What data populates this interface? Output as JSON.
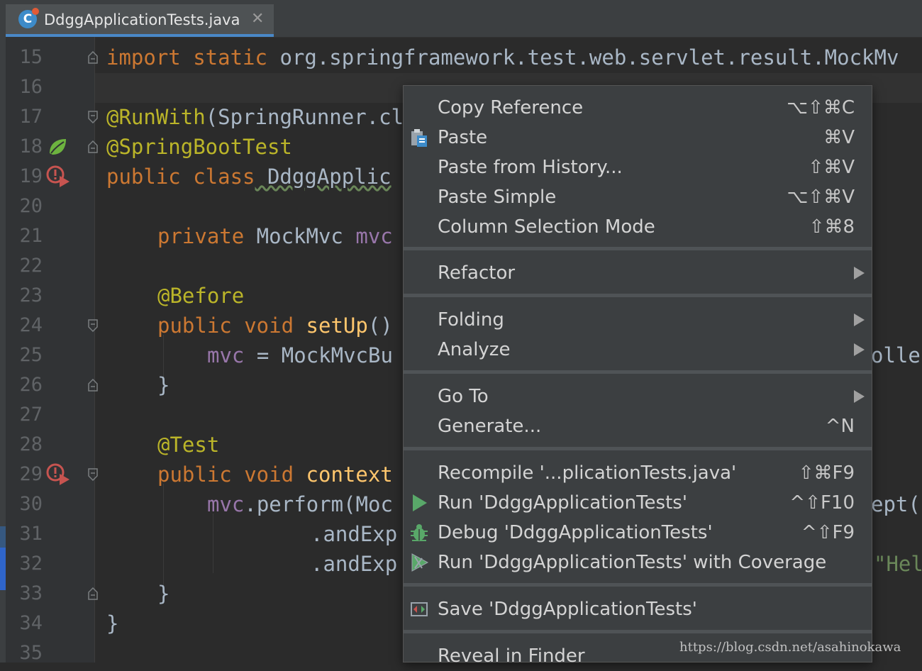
{
  "tab": {
    "title": "DdggApplicationTests.java",
    "icon_letter": "C",
    "close": "✕"
  },
  "gutter": {
    "line_numbers": [
      "15",
      "16",
      "17",
      "18",
      "19",
      "20",
      "21",
      "22",
      "23",
      "24",
      "25",
      "26",
      "27",
      "28",
      "29",
      "30",
      "31",
      "32",
      "33",
      "34",
      "35"
    ]
  },
  "code": {
    "l15": {
      "kw": "import static",
      "rest": " org.springframework.test.web.servlet.result.MockMv"
    },
    "l17": {
      "ann": "@RunWith",
      "rest": "(SpringRunner.cl"
    },
    "l18": {
      "ann": "@SpringBootTest"
    },
    "l19": {
      "kw": "public class",
      "rest": " DdggApplic"
    },
    "l21": {
      "kw": "private",
      "type": " MockMvc ",
      "fld": "mvc"
    },
    "l23": {
      "ann": "@Before"
    },
    "l24": {
      "kw": "public void",
      "fn": " setUp",
      "rest": "()"
    },
    "l25": {
      "fld": "mvc",
      "rest": " = MockMvcBu",
      "tail": "olle"
    },
    "l26": {
      "rest": "}"
    },
    "l28": {
      "ann": "@Test"
    },
    "l29": {
      "kw": "public void",
      "fn": " context"
    },
    "l30": {
      "fld": "mvc",
      "rest": ".perform(Moc",
      "tail": "ept("
    },
    "l31": {
      "rest": ".andExp"
    },
    "l32": {
      "rest": ".andExp",
      "tail": "\"Hel"
    },
    "l33": {
      "rest": "}"
    },
    "l34": {
      "rest": "}"
    }
  },
  "context_menu": {
    "copy_reference": {
      "label": "Copy Reference",
      "shortcut": "⌥⇧⌘C"
    },
    "paste": {
      "label": "Paste",
      "shortcut": "⌘V",
      "icon": "clipboard-icon"
    },
    "paste_history": {
      "label": "Paste from History...",
      "shortcut": "⇧⌘V"
    },
    "paste_simple": {
      "label": "Paste Simple",
      "shortcut": "⌥⇧⌘V"
    },
    "column_selection": {
      "label": "Column Selection Mode",
      "shortcut": "⇧⌘8"
    },
    "refactor": {
      "label": "Refactor"
    },
    "folding": {
      "label": "Folding"
    },
    "analyze": {
      "label": "Analyze"
    },
    "goto": {
      "label": "Go To"
    },
    "generate": {
      "label": "Generate...",
      "shortcut": "^N"
    },
    "recompile": {
      "label": "Recompile '...plicationTests.java'",
      "shortcut": "⇧⌘F9"
    },
    "run": {
      "label": "Run 'DdggApplicationTests'",
      "shortcut": "^⇧F10",
      "icon": "run-icon"
    },
    "debug": {
      "label": "Debug 'DdggApplicationTests'",
      "shortcut": "^⇧F9",
      "icon": "debug-bug-icon"
    },
    "coverage": {
      "label": "Run 'DdggApplicationTests' with Coverage",
      "icon": "coverage-icon"
    },
    "save": {
      "label": "Save 'DdggApplicationTests'",
      "icon": "save-icon"
    },
    "reveal": {
      "label": "Reveal in Finder"
    }
  },
  "watermark": "https://blog.csdn.net/asahinokawa",
  "colors": {
    "keyword": "#cc7832",
    "annotation": "#bbb529",
    "field": "#9876aa",
    "method": "#ffc66d",
    "string": "#6a8759",
    "menu_bg": "#3c3f41",
    "editor_bg": "#2b2b2b"
  }
}
